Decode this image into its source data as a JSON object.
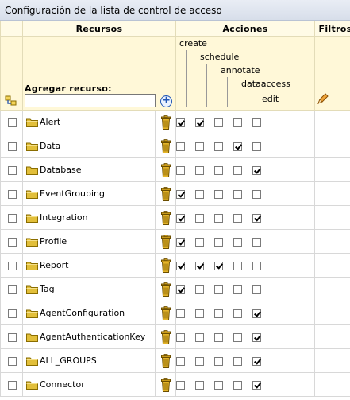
{
  "window": {
    "title": "Configuración de la lista de control de acceso"
  },
  "headers": {
    "recursos": "Recursos",
    "acciones": "Acciones",
    "filtros": "Filtros"
  },
  "add_resource": {
    "label": "Agregar recurso:",
    "value": "",
    "placeholder": ""
  },
  "actions": [
    "create",
    "schedule",
    "annotate",
    "dataaccess",
    "edit"
  ],
  "resources": [
    {
      "name": "Alert",
      "selected": false,
      "perms": [
        true,
        true,
        false,
        false,
        false
      ]
    },
    {
      "name": "Data",
      "selected": false,
      "perms": [
        false,
        false,
        false,
        true,
        false
      ]
    },
    {
      "name": "Database",
      "selected": false,
      "perms": [
        false,
        false,
        false,
        false,
        true
      ]
    },
    {
      "name": "EventGrouping",
      "selected": false,
      "perms": [
        true,
        false,
        false,
        false,
        false
      ]
    },
    {
      "name": "Integration",
      "selected": false,
      "perms": [
        true,
        false,
        false,
        false,
        true
      ]
    },
    {
      "name": "Profile",
      "selected": false,
      "perms": [
        true,
        false,
        false,
        false,
        false
      ]
    },
    {
      "name": "Report",
      "selected": false,
      "perms": [
        true,
        true,
        true,
        false,
        false
      ]
    },
    {
      "name": "Tag",
      "selected": false,
      "perms": [
        true,
        false,
        false,
        false,
        false
      ]
    },
    {
      "name": "AgentConfiguration",
      "selected": false,
      "perms": [
        false,
        false,
        false,
        false,
        true
      ]
    },
    {
      "name": "AgentAuthenticationKey",
      "selected": false,
      "perms": [
        false,
        false,
        false,
        false,
        true
      ]
    },
    {
      "name": "ALL_GROUPS",
      "selected": false,
      "perms": [
        false,
        false,
        false,
        false,
        true
      ]
    },
    {
      "name": "Connector",
      "selected": false,
      "perms": [
        false,
        false,
        false,
        false,
        true
      ]
    }
  ],
  "icons": {
    "folder": "folder-icon",
    "trash": "trash-icon",
    "add": "add-icon",
    "edit": "pencil-icon",
    "select_all": "select-grid-icon"
  }
}
